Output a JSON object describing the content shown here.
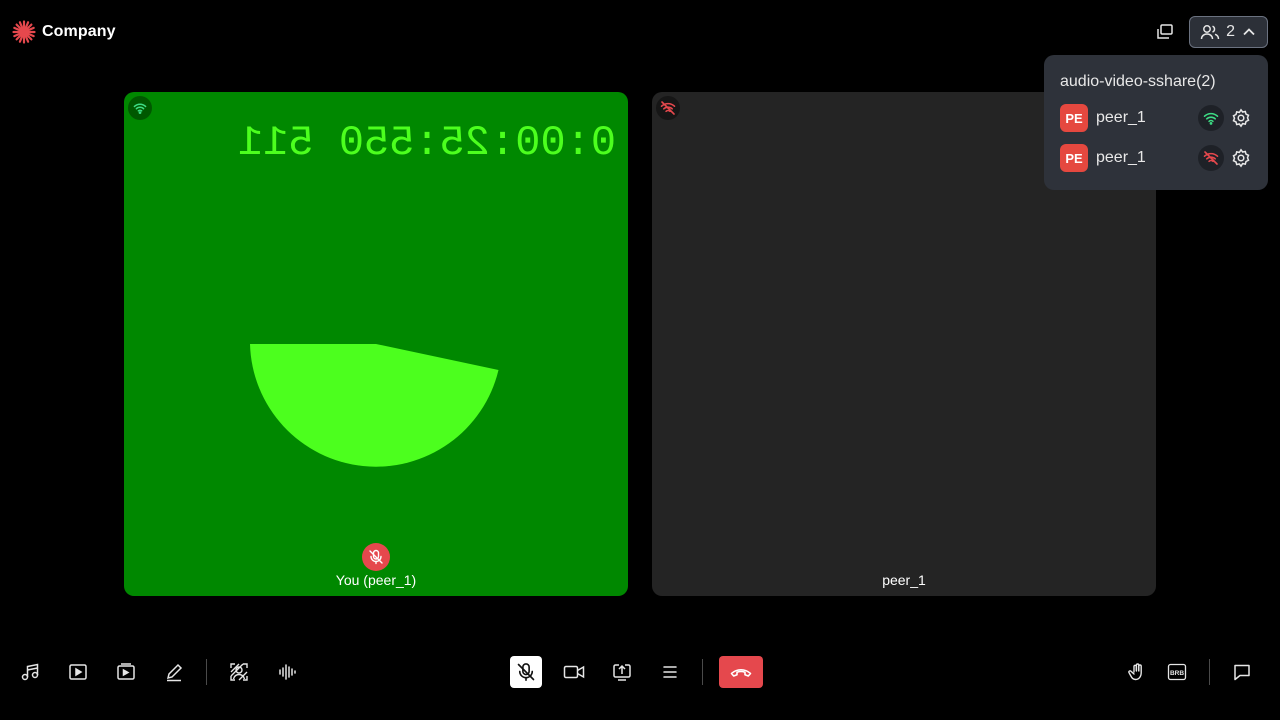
{
  "header": {
    "brand_name": "Company",
    "participant_count": "2",
    "accent_color": "#e5484d"
  },
  "participants_panel": {
    "title": "audio-video-sshare(2)",
    "peers": [
      {
        "initials": "PE",
        "name": "peer_1",
        "network": "good",
        "network_icon": "wifi-icon"
      },
      {
        "initials": "PE",
        "name": "peer_1",
        "network": "disconnected",
        "network_icon": "wifi-off-icon"
      }
    ]
  },
  "tiles": [
    {
      "name": "You (peer_1)",
      "network": "good",
      "audio_muted": true,
      "video_text": "0:00:25:550 511",
      "background": "#008800"
    },
    {
      "name": "peer_1",
      "network": "disconnected",
      "audio_muted": false,
      "background": "#242424"
    }
  ],
  "toolbar": {
    "left_icons": [
      "music-icon",
      "play-video-icon",
      "video-file-icon",
      "pencil-icon",
      "virtual-background-icon",
      "audio-waveform-icon"
    ],
    "center_icons": [
      "mic-off-icon",
      "video-camera-icon",
      "screen-share-icon",
      "menu-icon",
      "leave-call-icon"
    ],
    "right_icons": [
      "raise-hand-icon",
      "brb-icon",
      "chat-icon"
    ]
  }
}
